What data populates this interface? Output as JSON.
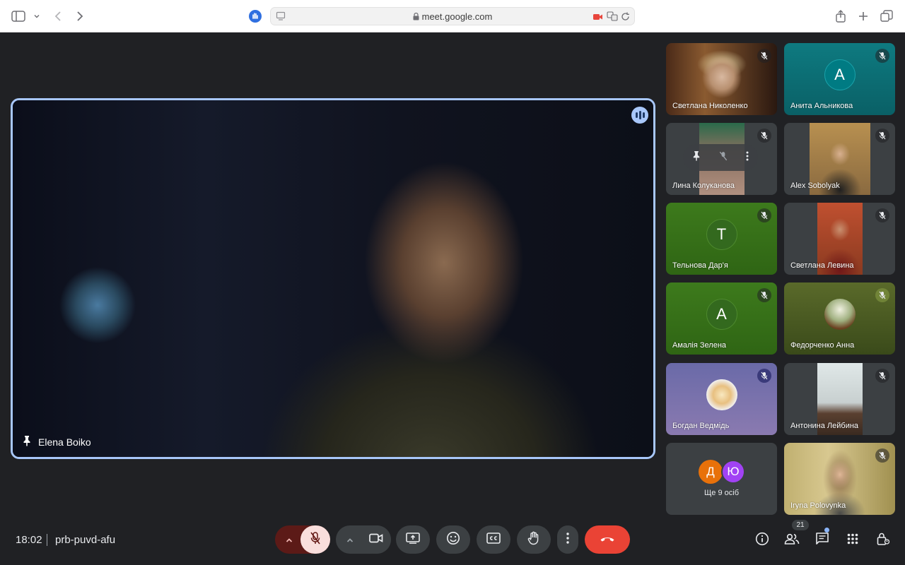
{
  "browser": {
    "url": "meet.google.com"
  },
  "meeting": {
    "time": "18:02",
    "code": "prb-puvd-afu"
  },
  "main_speaker": {
    "name": "Elena Boiko"
  },
  "participants": [
    {
      "name": "Светлана Николенко",
      "type": "video",
      "muted": true
    },
    {
      "name": "Анита Альникова",
      "type": "avatar",
      "initial": "A",
      "color": "#007b83",
      "muted": true
    },
    {
      "name": "Лина Колуканова",
      "type": "video",
      "muted": true
    },
    {
      "name": "Alex Sobolyak",
      "type": "video",
      "muted": true
    },
    {
      "name": "Тельнова Дар'я",
      "type": "avatar",
      "initial": "T",
      "color": "#33691e",
      "muted": true
    },
    {
      "name": "Светлана Левина",
      "type": "video",
      "muted": true
    },
    {
      "name": "Амалія Зелена",
      "type": "avatar",
      "initial": "A",
      "color": "#33691e",
      "muted": true
    },
    {
      "name": "Федорченко Анна",
      "type": "photo",
      "muted": true
    },
    {
      "name": "Богдан Ведмідь",
      "type": "photo",
      "muted": true
    },
    {
      "name": "Антонина Лейбина",
      "type": "video",
      "muted": true
    },
    {
      "name": "Iryna Polovynka",
      "type": "video",
      "muted": true
    }
  ],
  "others": {
    "initials": [
      "Д",
      "Ю"
    ],
    "colors": [
      "#e8710a",
      "#a142f4"
    ],
    "label": "Ще 9 осіб"
  },
  "people_count": "21",
  "colors": {
    "accent": "#a8c7fa",
    "end_call": "#ea4335",
    "mic_off": "#f9dedc"
  }
}
